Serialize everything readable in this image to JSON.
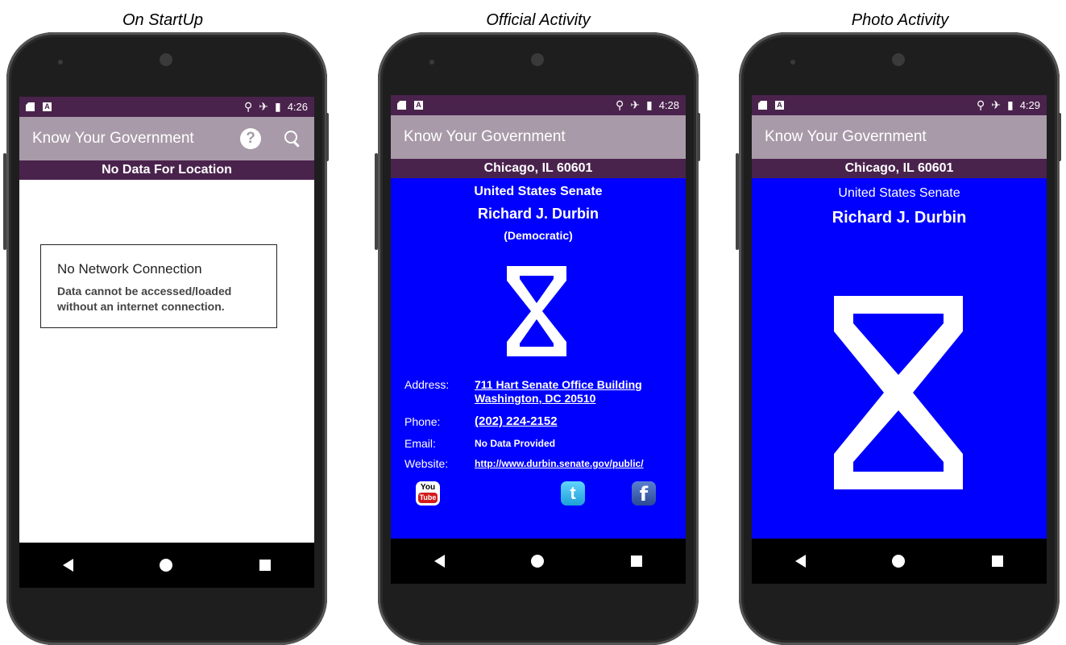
{
  "captions": [
    "On StartUp",
    "Official Activity",
    "Photo Activity"
  ],
  "app_title": "Know Your Government",
  "screen1": {
    "time": "4:26",
    "location": "No Data For Location",
    "dialog_title": "No Network Connection",
    "dialog_line1": "Data cannot be accessed/loaded",
    "dialog_line2": "without an internet connection."
  },
  "screen2": {
    "time": "4:28",
    "location": "Chicago, IL 60601",
    "office": "United States Senate",
    "name": "Richard J. Durbin",
    "party": "(Democratic)",
    "address_label": "Address:",
    "address_line1": "711 Hart Senate Office Building",
    "address_line2": "Washington, DC 20510",
    "phone_label": "Phone:",
    "phone": "(202) 224-2152",
    "email_label": "Email:",
    "email": "No Data Provided",
    "website_label": "Website:",
    "website": "http://www.durbin.senate.gov/public/",
    "youtube_top": "You",
    "youtube_bottom": "Tube",
    "twitter_letter": "t",
    "facebook_letter": "f"
  },
  "screen3": {
    "time": "4:29",
    "location": "Chicago, IL 60601",
    "office": "United States Senate",
    "name": "Richard J. Durbin"
  },
  "icons": {
    "help": "?",
    "airplane": "✈",
    "location_pin": "⚲",
    "battery": "▮"
  },
  "colors": {
    "status_bar": "#4a234d",
    "app_bar": "#a89aa8",
    "official_background": "#0000ff"
  }
}
